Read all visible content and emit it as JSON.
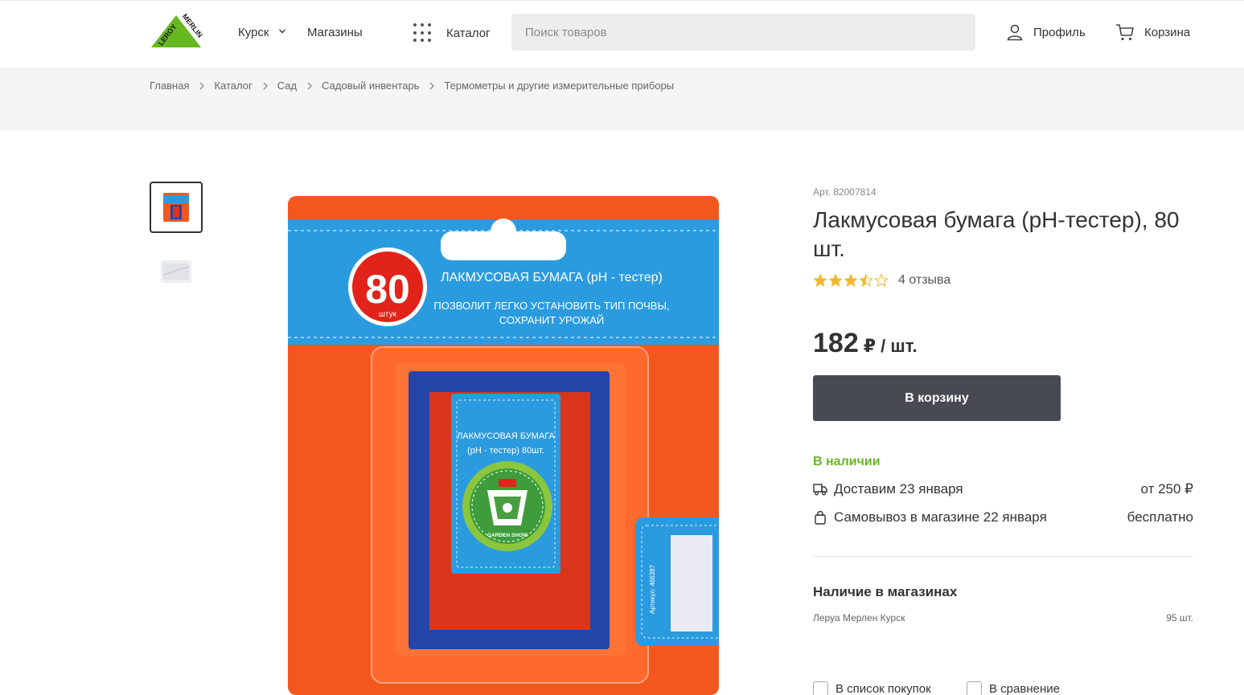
{
  "header": {
    "city": "Курск",
    "shops": "Магазины",
    "catalog": "Каталог",
    "search_placeholder": "Поиск товаров",
    "profile": "Профиль",
    "cart": "Корзина",
    "logo_text": "LEROY MERLIN"
  },
  "breadcrumbs": [
    "Главная",
    "Каталог",
    "Сад",
    "Садовый инвентарь",
    "Термометры и другие измерительные приборы"
  ],
  "product": {
    "article": "Арт. 82007814",
    "title": "Лакмусовая бумага (pH-тестер), 80 шт.",
    "rating_stars": 3.5,
    "reviews": "4 отзыва",
    "price": "182",
    "price_unit": "₽ / шт.",
    "add_to_cart": "В корзину",
    "stock": "В наличии",
    "delivery_label": "Доставим 23 января",
    "delivery_price": "от 250 ₽",
    "pickup_label": "Самовывоз в магазине 22 января",
    "pickup_price": "бесплатно",
    "stores_title": "Наличие в магазинах",
    "store_name": "Леруа Мерлен Курск",
    "store_qty": "95 шт.",
    "shopping_list": "В список покупок",
    "compare": "В сравнение"
  },
  "package": {
    "count": "80",
    "count_unit": "штук",
    "header_title": "ЛАКМУСОВАЯ БУМАГА (pH - тестер)",
    "header_line1": "ПОЗВОЛИТ ЛЕГКО УСТАНОВИТЬ ТИП ПОЧВЫ,",
    "header_line2": "СОХРАНИТ УРОЖАЙ",
    "inner_line1": "ЛАКМУСОВАЯ БУМАГА",
    "inner_line2": "(pH - тестер) 80шт.",
    "badge": "GARDEN SHOW",
    "sku": "Артикул: 466387"
  },
  "colors": {
    "brand_green": "#66b821",
    "button_dark": "#474a53",
    "star": "#f3b82e",
    "package_orange": "#f2581d",
    "package_blue": "#2b9be0"
  }
}
